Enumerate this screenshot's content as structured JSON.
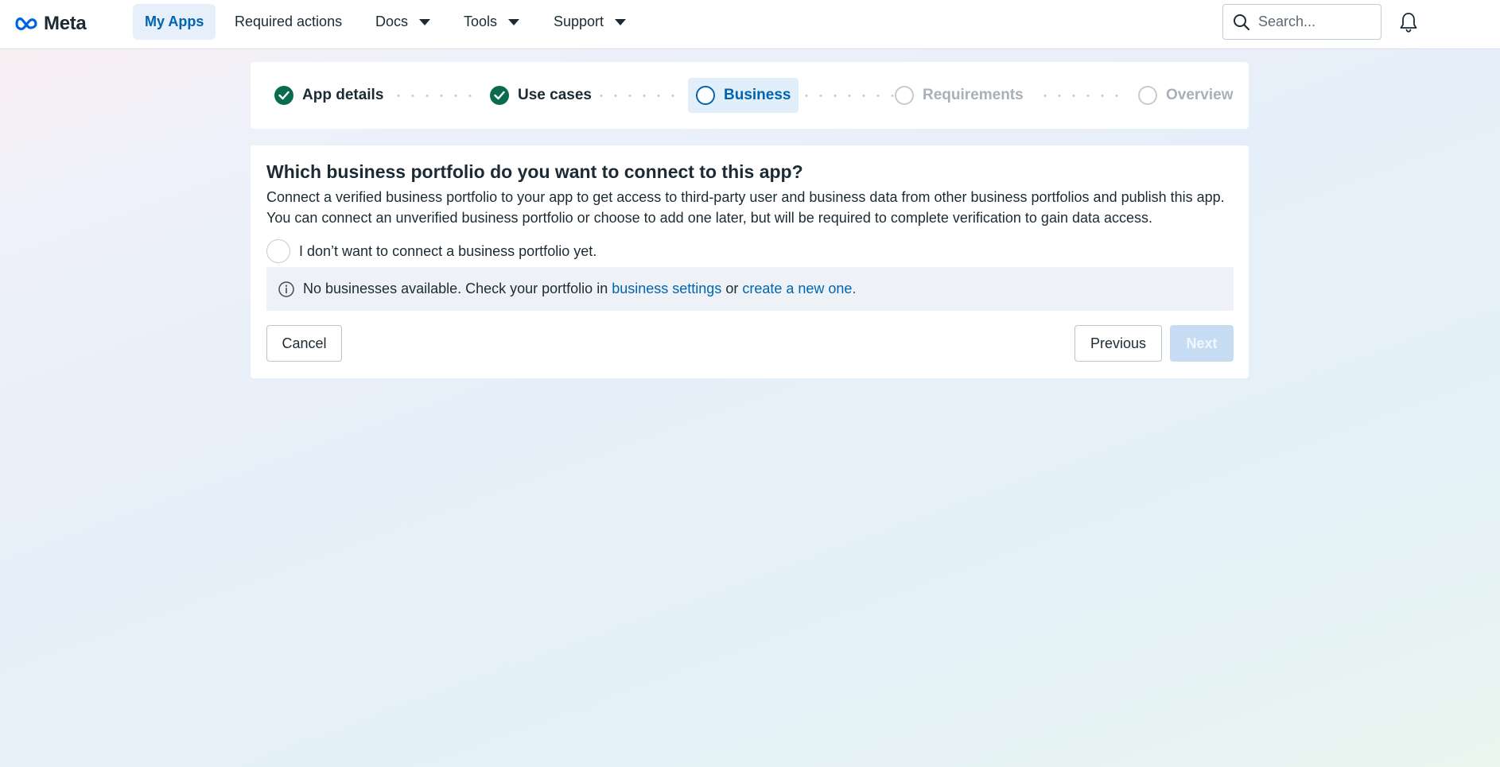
{
  "brand": {
    "name": "Meta",
    "color": "#0064e0"
  },
  "nav": {
    "my_apps": "My Apps",
    "required_actions": "Required actions",
    "docs": "Docs",
    "tools": "Tools",
    "support": "Support"
  },
  "search": {
    "placeholder": "Search..."
  },
  "stepper": {
    "steps": [
      {
        "label": "App details",
        "state": "done"
      },
      {
        "label": "Use cases",
        "state": "done"
      },
      {
        "label": "Business",
        "state": "current"
      },
      {
        "label": "Requirements",
        "state": "todo"
      },
      {
        "label": "Overview",
        "state": "todo"
      }
    ]
  },
  "form": {
    "title": "Which business portfolio do you want to connect to this app?",
    "description_line1": "Connect a verified business portfolio to your app to get access to third-party user and business data from other business portfolios and publish this app.",
    "description_line2": "You can connect an unverified business portfolio or choose to add one later, but will be required to complete verification to gain data access.",
    "skip_option": "I don’t want to connect a business portfolio yet.",
    "notice": {
      "text_before": "No businesses available. Check your portfolio in",
      "link1": "business settings",
      "text_mid": "or",
      "link2": "create a new one."
    },
    "cancel_label": "Cancel",
    "previous_label": "Previous",
    "next_label": "Next"
  },
  "colors": {
    "accent": "#0064b1",
    "done_step": "#0a6b4f",
    "notice_bg": "#eef2f6",
    "next_disabled": "#c6dcf3"
  }
}
